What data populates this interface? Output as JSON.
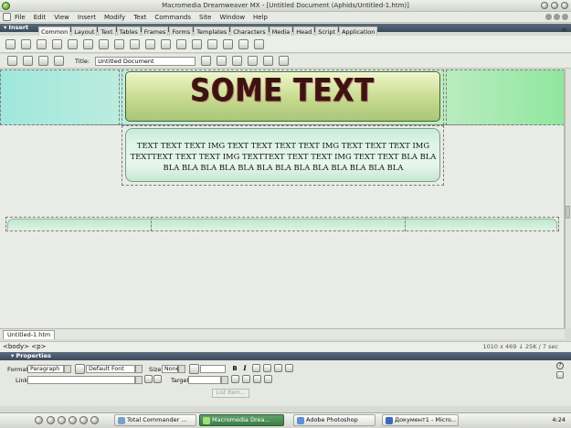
{
  "window": {
    "title": "Macromedia Dreamweaver MX - [Untitled Document (Aphids/Untitled-1.htm)]"
  },
  "menu": {
    "items": [
      "File",
      "Edit",
      "View",
      "Insert",
      "Modify",
      "Text",
      "Commands",
      "Site",
      "Window",
      "Help"
    ]
  },
  "insert_panel": {
    "title": "▾ Insert",
    "tabs": [
      "Common",
      "Layout",
      "Text",
      "Tables",
      "Frames",
      "Forms",
      "Templates",
      "Characters",
      "Media",
      "Head",
      "Script",
      "Application"
    ],
    "active_tab": "Common"
  },
  "doc_toolbar": {
    "title_label": "Title:",
    "title_value": "Untitled Document"
  },
  "document": {
    "header_text": "SOME TEXT",
    "body_text": "TEXT TEXT TEXT IMG TEXT TEXT TEXT TEXT IMG TEXT TEXT TEXT IMG TEXTTEXT TEXT TEXT IMG TEXTTEXT TEXT TEXT IMG TEXT TEXT BLA BLA BLA BLA BLA BLA BLA BLA BLA BLA BLA BLA BLA BLA BLA"
  },
  "doc_tab": "Untitled-1.htm",
  "status": {
    "tag_selector": "<body> <p>",
    "size_info": "1010 x 469 ↓ 25K / 7 sec"
  },
  "properties": {
    "title": "▾ Properties",
    "format_label": "Format",
    "format_value": "Paragraph",
    "font_value": "Default Font",
    "size_label": "Size",
    "size_value": "None",
    "link_label": "Link",
    "target_label": "Target",
    "list_item_button": "List Item..."
  },
  "taskbar": {
    "buttons": [
      "Total Commander ...",
      "Macromedia Drea...",
      "Adobe Photoshop",
      "Документ1 - Micro..."
    ],
    "active_index": 1,
    "clock": "4:24"
  }
}
